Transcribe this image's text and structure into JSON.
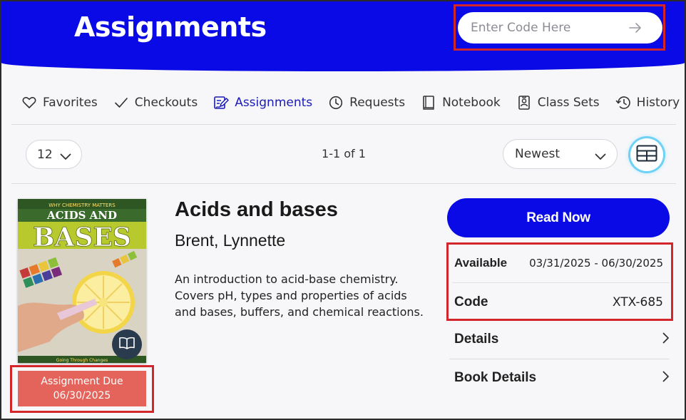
{
  "header": {
    "title": "Assignments",
    "code_input_placeholder": "Enter Code Here",
    "submit_icon": "arrow-right-icon"
  },
  "nav": {
    "items": [
      {
        "label": "Favorites",
        "icon": "heart-icon"
      },
      {
        "label": "Checkouts",
        "icon": "check-icon"
      },
      {
        "label": "Assignments",
        "icon": "assignment-edit-icon",
        "active": true
      },
      {
        "label": "Requests",
        "icon": "clock-icon"
      },
      {
        "label": "Notebook",
        "icon": "notebook-icon"
      },
      {
        "label": "Class Sets",
        "icon": "badge-icon"
      },
      {
        "label": "History",
        "icon": "history-icon"
      }
    ]
  },
  "toolbar": {
    "per_page": "12",
    "pagination": "1-1 of 1",
    "sort": "Newest",
    "view_icon": "grid-view-icon"
  },
  "book": {
    "title": "Acids and bases",
    "author": "Brent, Lynnette",
    "description": "An introduction to acid-base chemistry. Covers pH, types and properties of acids and bases, buffers, and chemical reactions.",
    "cover": {
      "series": "WHY CHEMISTRY MATTERS",
      "title_line1": "ACIDS AND",
      "title_line2": "BASES",
      "tagline": "Going Through Changes"
    },
    "due_label": "Assignment Due",
    "due_date": "06/30/2025",
    "read_now_label": "Read Now",
    "available_label": "Available",
    "available_value": "03/31/2025 - 06/30/2025",
    "code_label": "Code",
    "code_value": "XTX-685",
    "details_label": "Details",
    "book_details_label": "Book Details"
  },
  "colors": {
    "header_blue": "#0a0ae6",
    "highlight_red": "#d3262b",
    "due_badge": "#e4645b",
    "active_nav": "#1a1ab8"
  }
}
